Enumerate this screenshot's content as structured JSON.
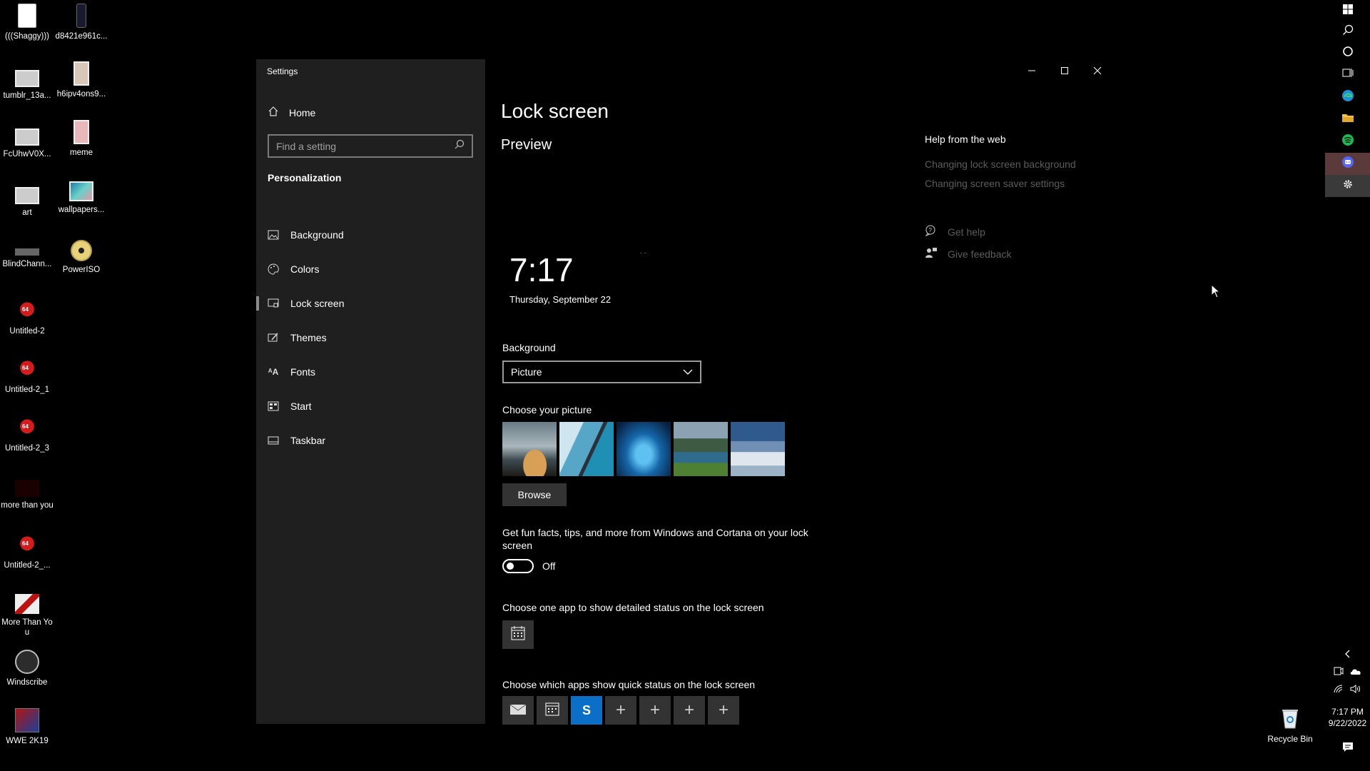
{
  "desktop": {
    "icons": [
      {
        "label": "(((Shaggy)))",
        "icon": "document-icon"
      },
      {
        "label": "d8421e961c...",
        "icon": "phone-image-icon"
      },
      {
        "label": "tumblr_13a...",
        "icon": "image-icon"
      },
      {
        "label": "h6ipv4ons9...",
        "icon": "image-icon"
      },
      {
        "label": "FcUhwV0X...",
        "icon": "image-icon"
      },
      {
        "label": "meme",
        "icon": "image-icon"
      },
      {
        "label": "art",
        "icon": "image-icon"
      },
      {
        "label": "wallpapers...",
        "icon": "image-icon"
      },
      {
        "label": "BlindChann...",
        "icon": "app-icon"
      },
      {
        "label": "PowerISO",
        "icon": "disc-icon"
      },
      {
        "label": "Untitled-2",
        "icon": "psd-icon"
      },
      {
        "label": "Untitled-2_1",
        "icon": "psd-icon"
      },
      {
        "label": "Untitled-2_3",
        "icon": "psd-icon"
      },
      {
        "label": "more than you",
        "icon": "image-icon"
      },
      {
        "label": "Untitled-2_...",
        "icon": "psd-icon"
      },
      {
        "label": "More Than You",
        "icon": "image-icon"
      },
      {
        "label": "Windscribe",
        "icon": "windscribe-icon"
      },
      {
        "label": "WWE 2K19",
        "icon": "game-icon"
      }
    ],
    "recycle_bin": "Recycle Bin"
  },
  "window": {
    "title": "Settings",
    "minimize": "—",
    "maximize": "☐",
    "close": "✕"
  },
  "nav": {
    "home": "Home",
    "search_placeholder": "Find a setting",
    "section": "Personalization",
    "items": [
      {
        "label": "Background",
        "icon": "image-icon"
      },
      {
        "label": "Colors",
        "icon": "palette-icon"
      },
      {
        "label": "Lock screen",
        "icon": "lock-screen-icon",
        "active": true
      },
      {
        "label": "Themes",
        "icon": "brush-icon"
      },
      {
        "label": "Fonts",
        "icon": "font-icon"
      },
      {
        "label": "Start",
        "icon": "start-icon"
      },
      {
        "label": "Taskbar",
        "icon": "taskbar-icon"
      }
    ]
  },
  "main": {
    "title": "Lock screen",
    "preview_heading": "Preview",
    "preview_time": "7:17",
    "preview_date": "Thursday, September 22",
    "background_label": "Background",
    "background_value": "Picture",
    "choose_picture_label": "Choose your picture",
    "browse_label": "Browse",
    "tips_text": "Get fun facts, tips, and more from Windows and Cortana on your lock screen",
    "tips_state": "Off",
    "detailed_status_label": "Choose one app to show detailed status on the lock screen",
    "quick_status_label": "Choose which apps show quick status on the lock screen",
    "quick_apps": [
      "mail-icon",
      "calendar-icon",
      "skype-icon",
      "plus-icon",
      "plus-icon",
      "plus-icon",
      "plus-icon"
    ]
  },
  "help": {
    "heading": "Help from the web",
    "links": [
      "Changing lock screen background",
      "Changing screen saver settings"
    ],
    "get_help": "Get help",
    "feedback": "Give feedback"
  },
  "taskbar": {
    "time": "7:17 PM",
    "date": "9/22/2022"
  }
}
